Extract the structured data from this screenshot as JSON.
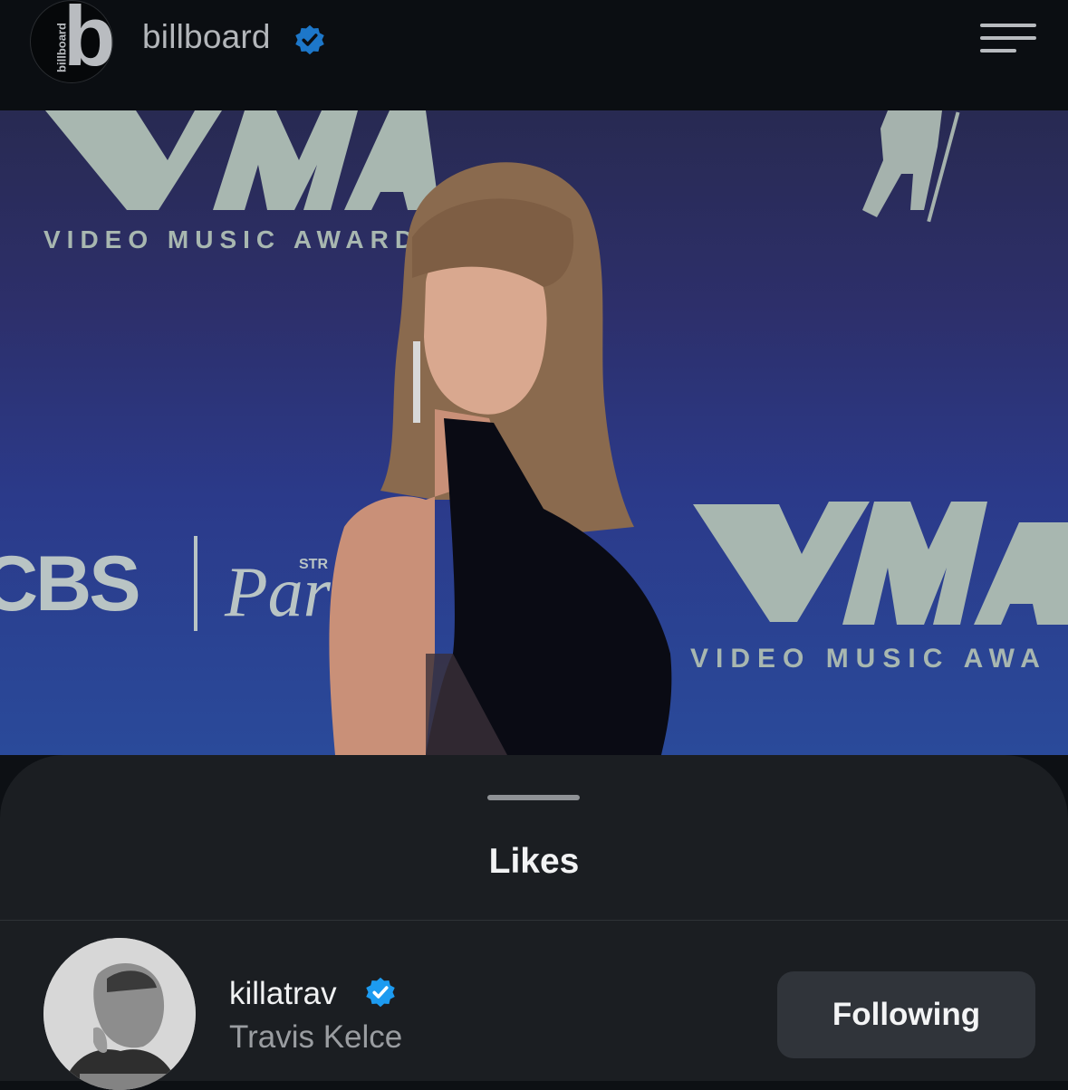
{
  "header": {
    "logo_side_text": "billboard",
    "logo_letter": "b",
    "account_name": "billboard",
    "verified_icon": "verified-badge-icon",
    "menu_icon": "hamburger-menu-icon"
  },
  "photo": {
    "backdrop_text_1": "VIDEO MUSIC AWARD",
    "backdrop_text_2": "VIDEO MUSIC AWA",
    "sponsor_1": "CBS",
    "sponsor_2": "Para",
    "sponsor_2_small": "STR"
  },
  "sheet": {
    "title": "Likes",
    "likes": [
      {
        "username": "killatrav",
        "full_name": "Travis Kelce",
        "verified": true,
        "button_label": "Following"
      }
    ]
  },
  "colors": {
    "verified": "#1d9bf0",
    "sheet_bg": "#1b1e22",
    "button_bg": "#30343a"
  }
}
